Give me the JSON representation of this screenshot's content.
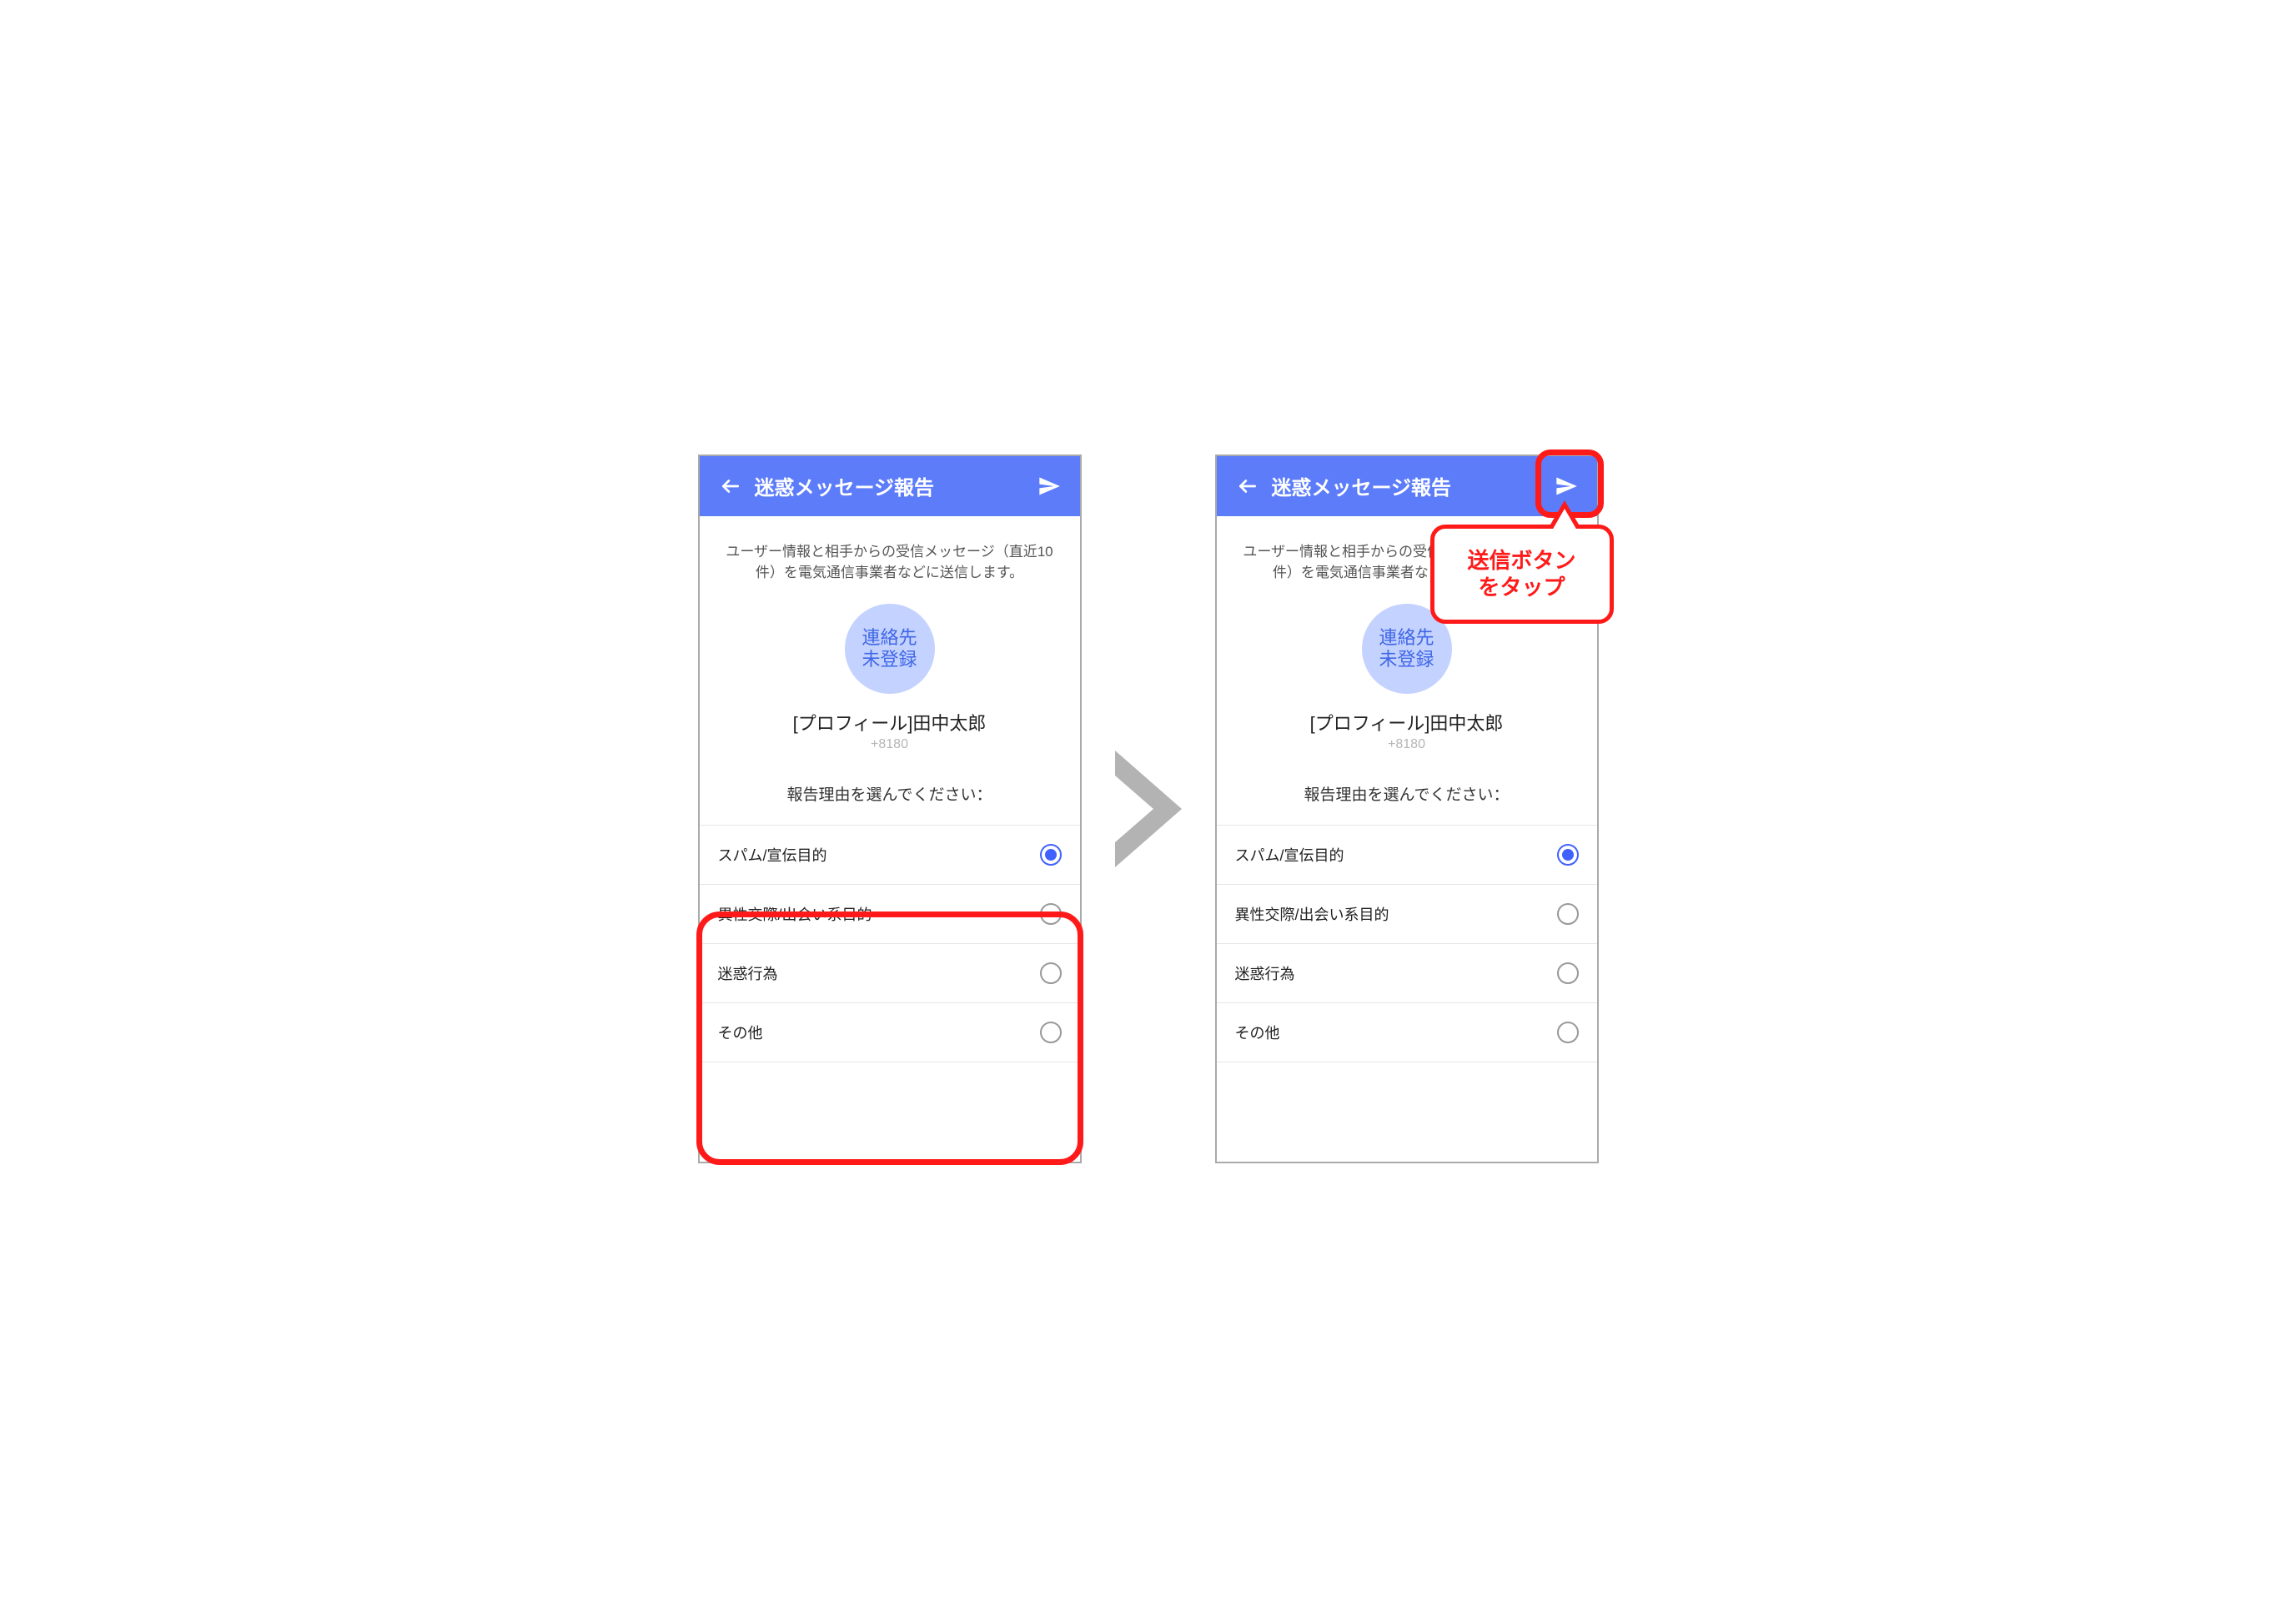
{
  "appbar": {
    "title": "迷惑メッセージ報告"
  },
  "body": {
    "description": "ユーザー情報と相手からの受信メッセージ（直近10件）を電気通信事業者などに送信します。",
    "avatar_line1": "連絡先",
    "avatar_line2": "未登録",
    "profile_name": "[プロフィール]田中太郎",
    "phone_number": "+8180",
    "reason_prompt": "報告理由を選んでください："
  },
  "options": [
    {
      "label": "スパム/宣伝目的",
      "selected": true
    },
    {
      "label": "異性交際/出会い系目的",
      "selected": false
    },
    {
      "label": "迷惑行為",
      "selected": false
    },
    {
      "label": "その他",
      "selected": false
    }
  ],
  "callout": {
    "line1": "送信ボタン",
    "line2": "をタップ"
  }
}
